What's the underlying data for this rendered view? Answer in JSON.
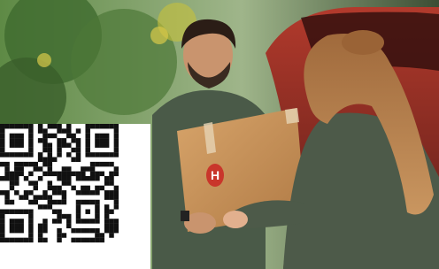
{
  "photo": {
    "description_icon": "delivery-photo",
    "box_logo_letter": "H"
  },
  "qr": {
    "icon": "qr-code-icon"
  },
  "colors": {
    "foliage": "#4f7a3a",
    "car_red": "#8a2a22",
    "box_brown": "#c8935a",
    "shirt_green": "#4a5a48",
    "qr_black": "#111111"
  }
}
